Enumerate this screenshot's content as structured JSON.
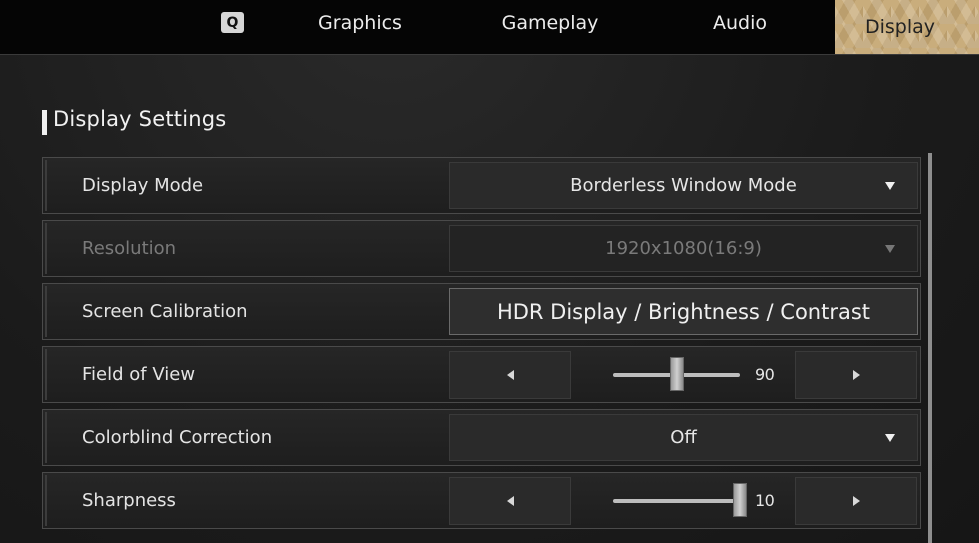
{
  "topnav": {
    "prev_key": "Q",
    "tabs": [
      {
        "label": "Graphics"
      },
      {
        "label": "Gameplay"
      },
      {
        "label": "Audio"
      },
      {
        "label": "Display",
        "active": true
      }
    ]
  },
  "section": {
    "title": "Display Settings"
  },
  "rows": {
    "display_mode": {
      "label": "Display Mode",
      "value": "Borderless Window Mode"
    },
    "resolution": {
      "label": "Resolution",
      "value": "1920x1080(16:9)",
      "disabled": true
    },
    "screen_calibration": {
      "label": "Screen Calibration",
      "button": "HDR Display / Brightness / Contrast"
    },
    "field_of_view": {
      "label": "Field of View",
      "value": "90",
      "slider_fraction": 0.5
    },
    "colorblind": {
      "label": "Colorblind Correction",
      "value": "Off"
    },
    "sharpness": {
      "label": "Sharpness",
      "value": "10",
      "slider_fraction": 1.0
    }
  },
  "colors": {
    "active_tab": "#c9ad7c",
    "background": "#1b1b1b",
    "text": "#e4e4e4"
  }
}
